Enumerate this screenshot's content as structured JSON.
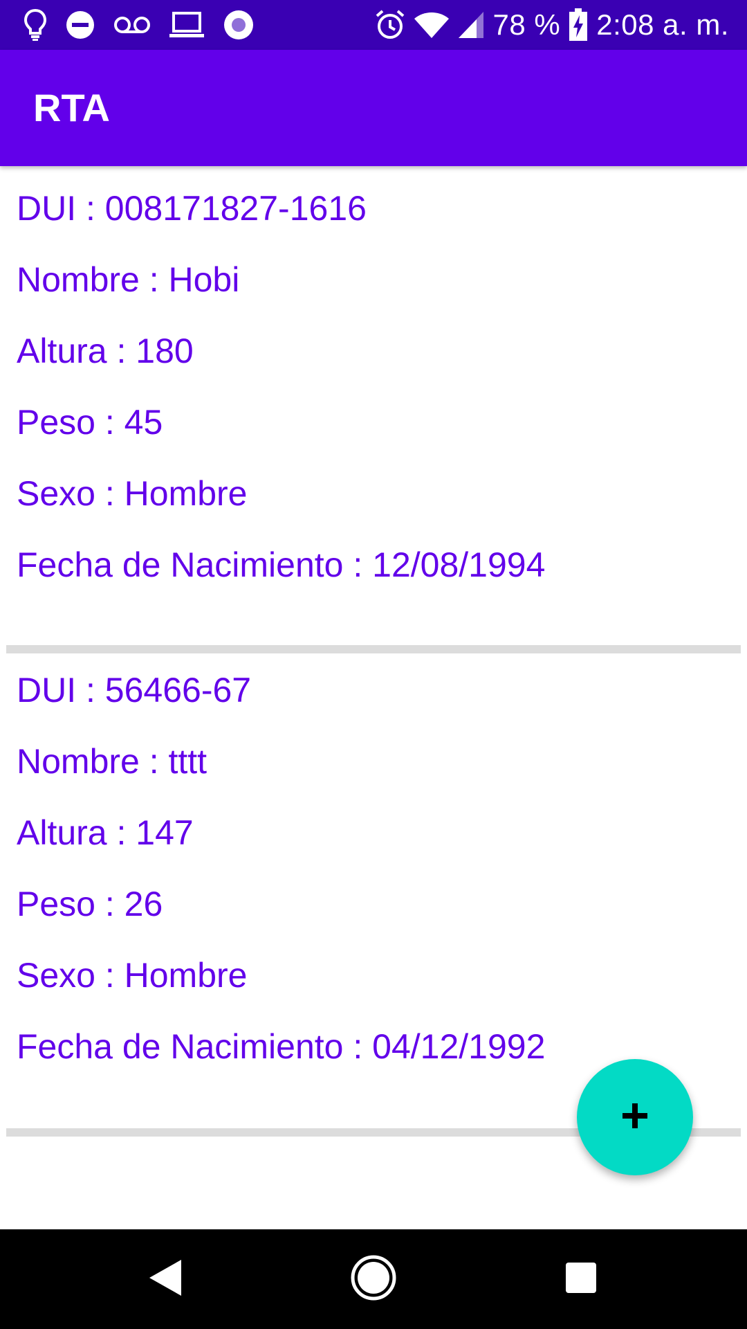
{
  "status_bar": {
    "battery_percent": "78 %",
    "time": "2:08 a. m.",
    "icons_left": [
      "lightbulb-icon",
      "do-not-disturb-icon",
      "voicemail-icon",
      "laptop-icon",
      "record-icon"
    ],
    "icons_right": [
      "alarm-icon",
      "wifi-icon",
      "signal-icon",
      "battery-charging-icon"
    ]
  },
  "app_bar": {
    "title": "RTA"
  },
  "records": [
    {
      "dui": "DUI : 008171827-1616",
      "nombre": "Nombre : Hobi",
      "altura": "Altura : 180",
      "peso": "Peso : 45",
      "sexo": "Sexo : Hombre",
      "fecha": "Fecha de Nacimiento : 12/08/1994"
    },
    {
      "dui": "DUI : 56466-67",
      "nombre": "Nombre : tttt",
      "altura": "Altura : 147",
      "peso": "Peso : 26",
      "sexo": "Sexo : Hombre",
      "fecha": "Fecha de Nacimiento : 04/12/1992"
    }
  ],
  "fab": {
    "icon": "add-icon"
  },
  "nav_bar": {
    "icons": [
      "back-icon",
      "home-icon",
      "recents-icon"
    ]
  },
  "colors": {
    "status_bar": "#3a00b3",
    "app_bar": "#6200ea",
    "text_accent": "#6200ea",
    "fab": "#03dac5",
    "divider": "#dcdcdc"
  }
}
